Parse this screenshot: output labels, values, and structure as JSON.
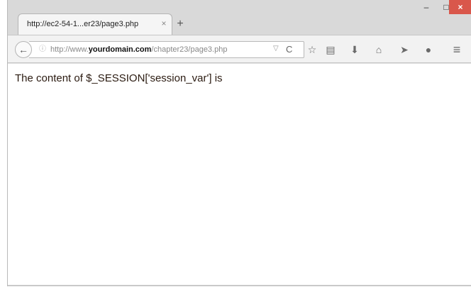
{
  "browser": {
    "tab": {
      "title": "http://ec2-54-1...er23/page3.php",
      "close_label": "×"
    },
    "new_tab_label": "+",
    "window_controls": {
      "minimize": "–",
      "maximize": "□",
      "close": "×"
    }
  },
  "navbar": {
    "back_label": "←",
    "url": {
      "prefix": "http://www.",
      "domain": "yourdomain.com",
      "path": "/chapter23/page3.php"
    },
    "url_dropdown_label": "▽",
    "reload_label": "C",
    "tools": [
      {
        "name": "bookmark-star-icon",
        "glyph": "☆"
      },
      {
        "name": "reading-list-icon",
        "glyph": "▤"
      },
      {
        "name": "download-icon",
        "glyph": "⬇"
      },
      {
        "name": "home-icon",
        "glyph": "⌂"
      },
      {
        "name": "send-icon",
        "glyph": "➤"
      },
      {
        "name": "chat-icon",
        "glyph": "●"
      },
      {
        "name": "menu-icon",
        "glyph": "≡"
      }
    ]
  },
  "page": {
    "text": "The content of $_SESSION['session_var'] is"
  }
}
